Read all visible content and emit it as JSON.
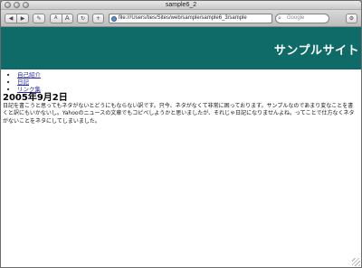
{
  "window": {
    "title": "sample6_2"
  },
  "toolbar": {
    "back_glyph": "◀",
    "forward_glyph": "▶",
    "edit_glyph": "✎",
    "text_smaller": "A",
    "text_bigger": "A",
    "reload_glyph": "↻",
    "add_glyph": "+",
    "url": "file:///Users/ties/Sites/web/sample/sample6_3/sample",
    "search_placeholder": "Google",
    "search_glyph": "⌕",
    "settings_glyph": "⚙",
    "icons": [
      "back-icon",
      "forward-icon",
      "edit-icon",
      "text-size-icon",
      "reload-icon",
      "add-bookmark-icon",
      "globe-icon",
      "search-icon",
      "settings-icon"
    ]
  },
  "page": {
    "header_color": "#0f6b67",
    "site_title": "サンプルサイト",
    "nav": [
      "自己紹介",
      "日記",
      "リンク集"
    ],
    "entry_date": "2005年9月2日",
    "entry_text": "日記を書こうと思ってもネタがないとどうにもならない訳です。只今、ネタがなくて非常に困っております。サンプルなのであまり変なことを書くと訳にもいかないし。Yahooのニュースの文章でもコピペしようかと思いましたが、それじゃ日記になりませんよね。ってことで仕方なくネタがないことをネタにしてしまいました。"
  }
}
